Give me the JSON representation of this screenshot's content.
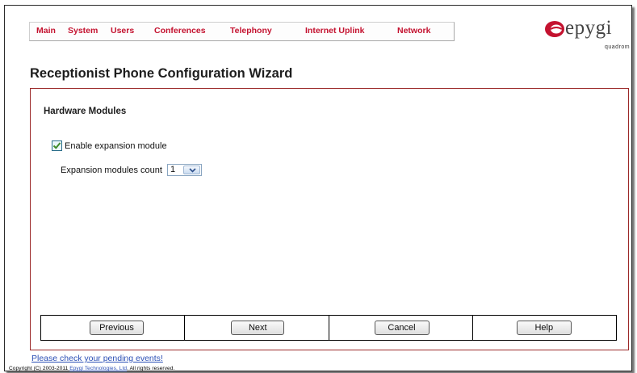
{
  "nav": {
    "items": [
      {
        "label": "Main"
      },
      {
        "label": "System"
      },
      {
        "label": "Users"
      },
      {
        "label": "Conferences"
      },
      {
        "label": "Telephony"
      },
      {
        "label": "Internet Uplink"
      },
      {
        "label": "Network"
      }
    ],
    "color": "#c4122f"
  },
  "logo": {
    "word": "epygi",
    "sub": "quadrom"
  },
  "page": {
    "title": "Receptionist Phone Configuration Wizard"
  },
  "section": {
    "title": "Hardware Modules",
    "enable_label": "Enable expansion module",
    "enable_checked": true,
    "count_label": "Expansion modules count",
    "count_value": "1"
  },
  "buttons": {
    "previous": "Previous",
    "next": "Next",
    "cancel": "Cancel",
    "help": "Help"
  },
  "footer": {
    "pending": "Please check your pending events!",
    "copyright_prefix": "Copyright (C) 2003-2011",
    "copyright_link": "Epygi Technologies, Ltd",
    "copyright_suffix": ". All rights reserved."
  }
}
